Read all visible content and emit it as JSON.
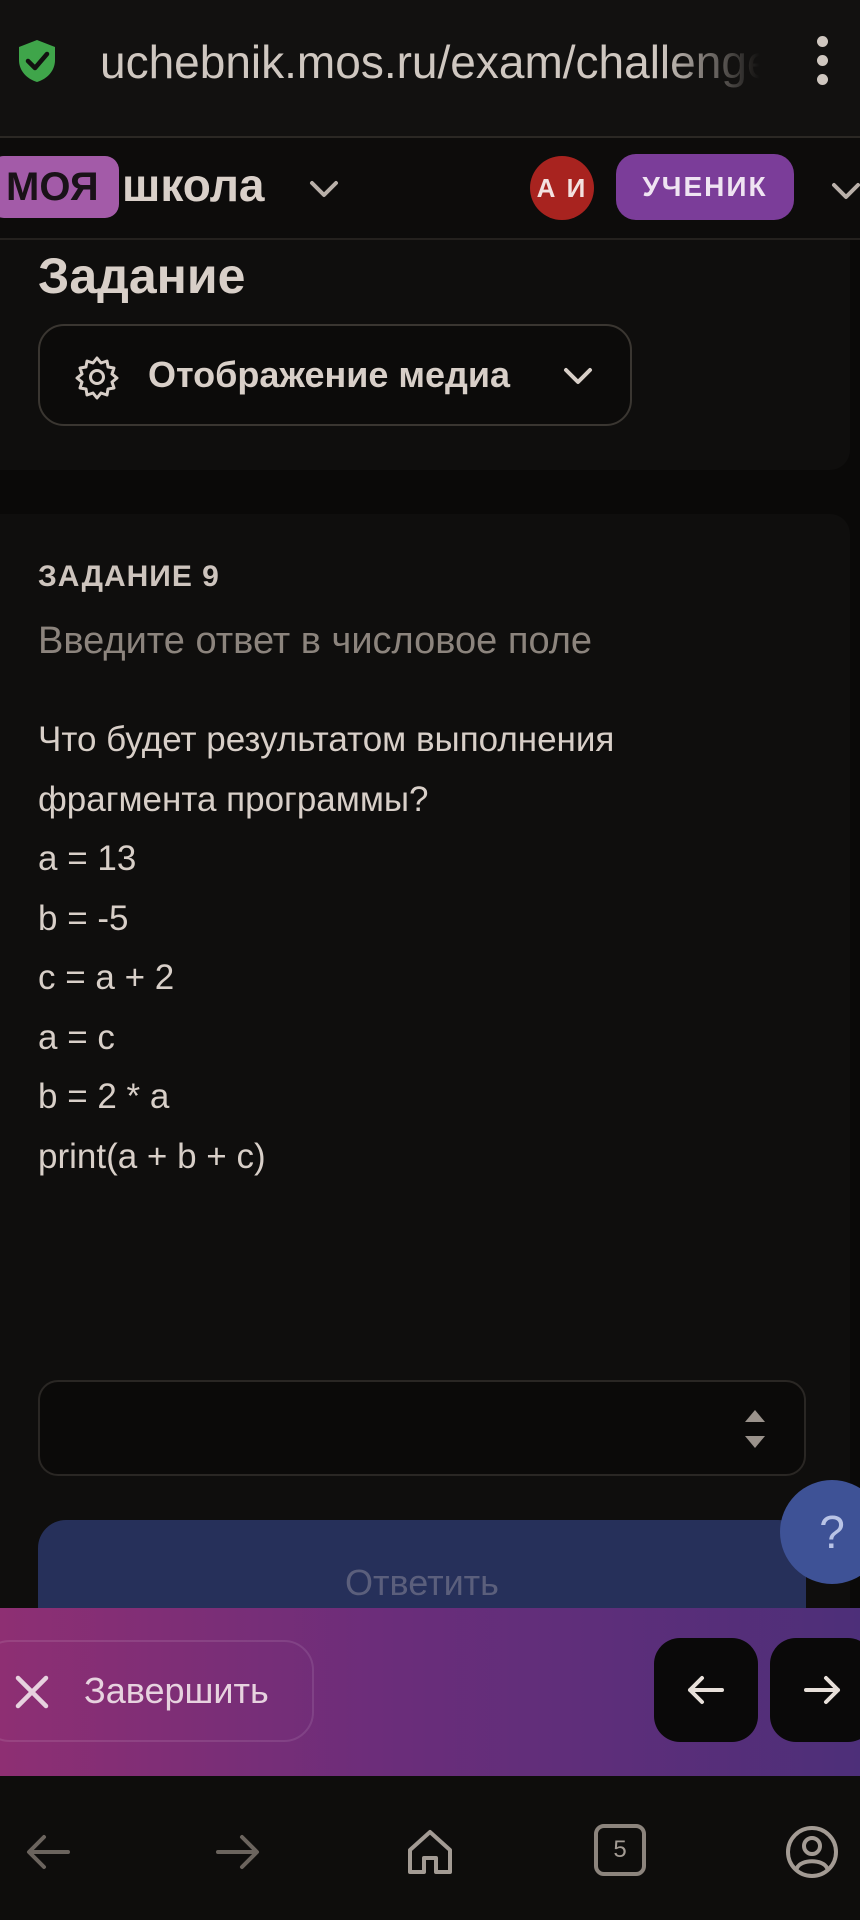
{
  "browser": {
    "url": "uchebnik.mos.ru/exam/challenge",
    "shield_icon": "shield-check-icon",
    "menu_icon": "kebab-menu-icon"
  },
  "header": {
    "logo_part1": "МОЯ",
    "logo_part2": "школа",
    "avatar_initials": "А И",
    "role": "УЧЕНИК"
  },
  "task_header": {
    "title": "Задание",
    "media_label": "Отображение медиа"
  },
  "task": {
    "number_label": "ЗАДАНИЕ 9",
    "hint": "Введите ответ в числовое поле",
    "question_lines": [
      "Что будет результатом выполнения",
      "фрагмента программы?",
      "a = 13",
      "b = -5",
      "c = a + 2",
      "a = c",
      "b = 2 * a",
      "print(a + b + c)"
    ],
    "answer_value": "",
    "submit_label": "Ответить",
    "help_label": "?"
  },
  "action_bar": {
    "finish_label": "Завершить"
  },
  "system_nav": {
    "tabs_count": "5"
  },
  "colors": {
    "background": "#0a0908",
    "accent_purple": "#7b3d99",
    "avatar_red": "#a8231f",
    "submit_blue": "#26305a",
    "help_blue": "#3e5296",
    "shield_green": "#3fa54a"
  }
}
